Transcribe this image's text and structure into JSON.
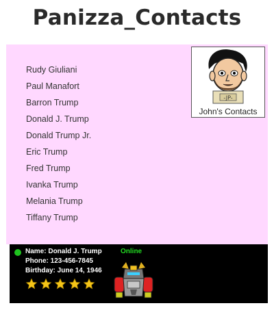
{
  "page": {
    "title": "Panizza_Contacts"
  },
  "logo": {
    "caption": "John's Contacts",
    "badge_text": "-JP-"
  },
  "contacts": [
    "Rudy Giuliani",
    "Paul Manafort",
    "Barron Trump",
    "Donald J. Trump",
    "Donald Trump Jr.",
    "Eric Trump",
    "Fred Trump",
    "Ivanka Trump",
    "Melania Trump",
    "Tiffany Trump"
  ],
  "detail": {
    "name_line": "Name: Donald J. Trump",
    "phone_line": "Phone: 123-456-7845",
    "birthday_line": "Birthday: June 14, 1946",
    "status": "Online",
    "rating": 5,
    "rating_max": 5,
    "colors": {
      "status_dot": "#1ec21e",
      "status_text": "#22dd22",
      "star": "#f5c518",
      "panel_bg": "#ffd8ff"
    },
    "avatar_icon": "robot-avatar-icon"
  }
}
